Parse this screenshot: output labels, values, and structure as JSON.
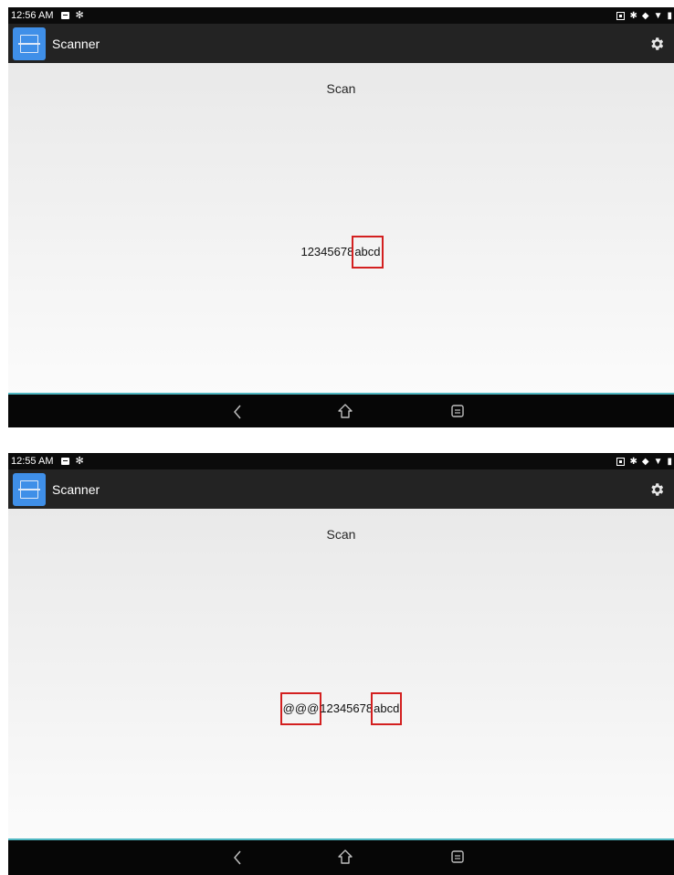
{
  "screens": [
    {
      "status": {
        "time": "12:56 AM"
      },
      "app": {
        "title": "Scanner"
      },
      "scan": {
        "button_label": "Scan",
        "result_segments": [
          {
            "text": "12345678",
            "highlighted": false
          },
          {
            "text": "abcd",
            "highlighted": true
          }
        ]
      }
    },
    {
      "status": {
        "time": "12:55 AM"
      },
      "app": {
        "title": "Scanner"
      },
      "scan": {
        "button_label": "Scan",
        "result_segments": [
          {
            "text": "@@@",
            "highlighted": true
          },
          {
            "text": "12345678",
            "highlighted": false
          },
          {
            "text": "abcd",
            "highlighted": true
          }
        ]
      }
    }
  ],
  "icons": {
    "app_logo": "barcode-scanner-icon",
    "settings": "gear-icon",
    "nav_back": "back-chevron-icon",
    "nav_home": "home-icon",
    "nav_recent": "recent-apps-icon"
  },
  "colors": {
    "status_bar": "#0b0b0b",
    "app_bar": "#232323",
    "logo_bg": "#3f8fe8",
    "highlight_box": "#d32020",
    "accent_line": "#4fb7c2",
    "nav_bar": "#060606"
  }
}
